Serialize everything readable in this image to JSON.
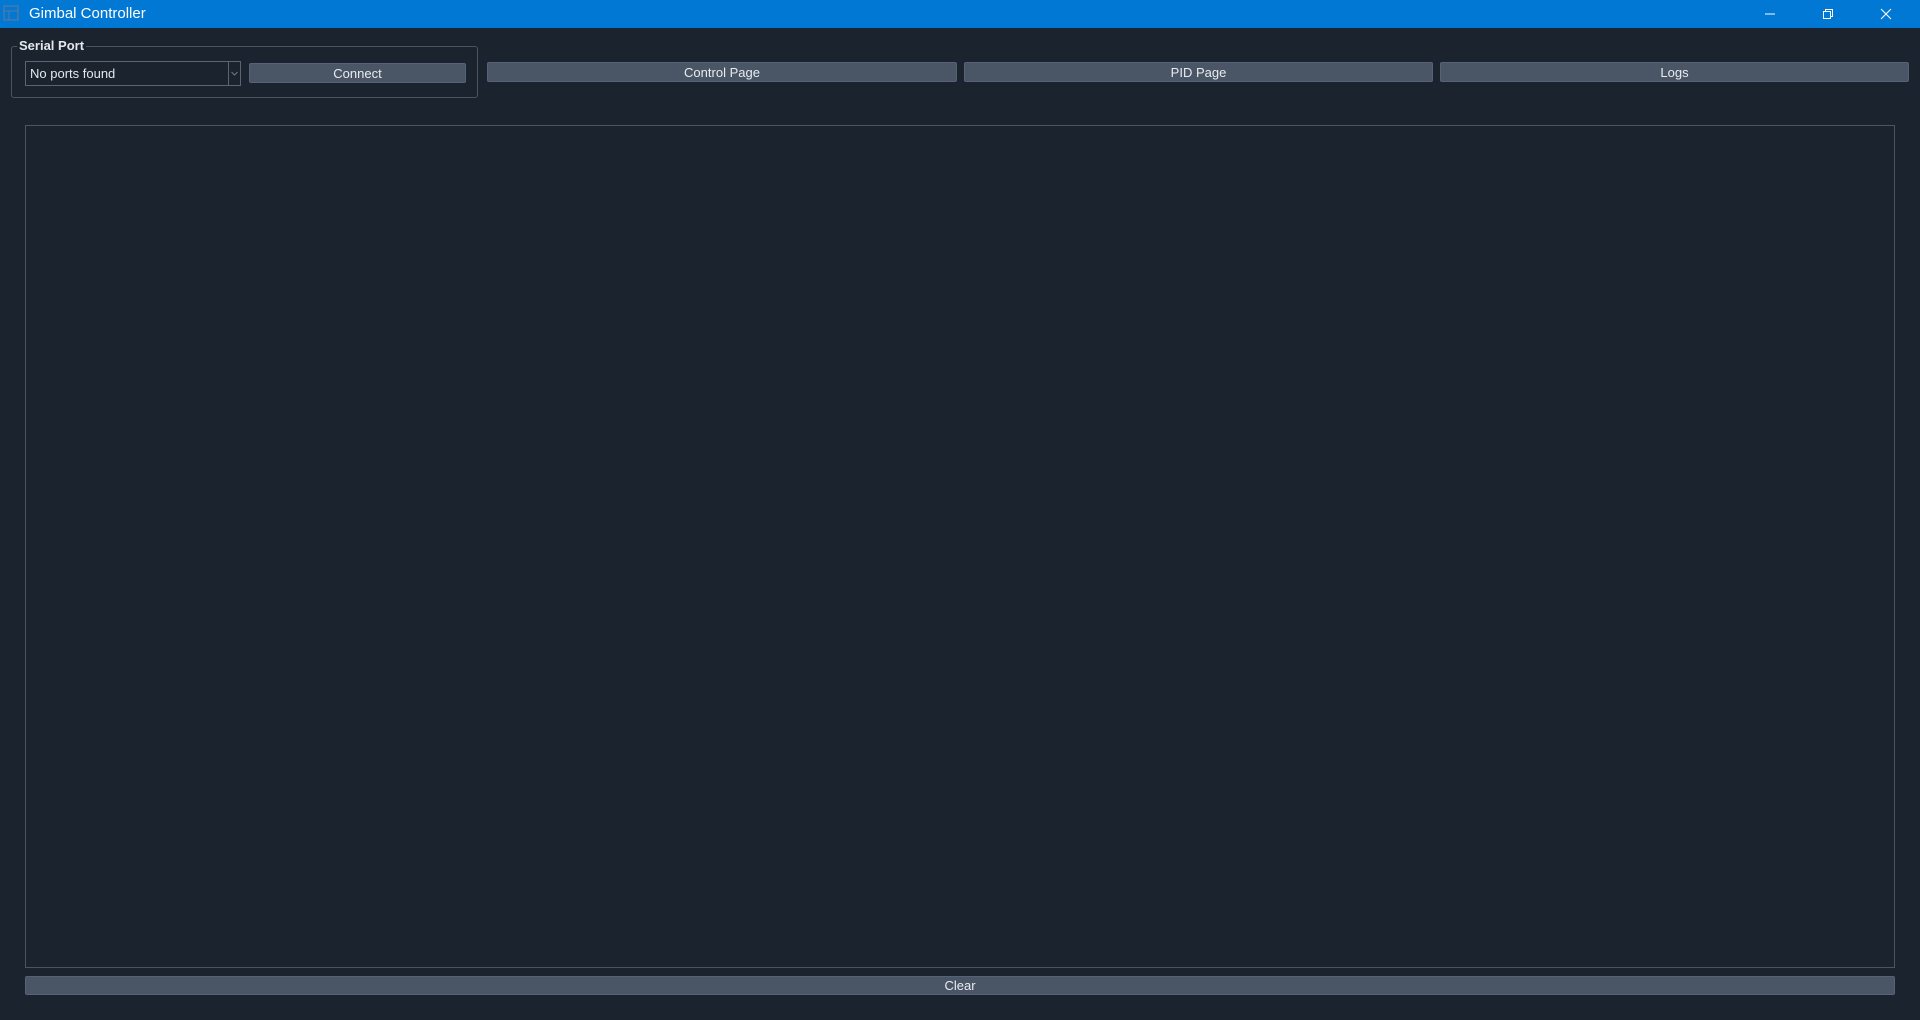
{
  "window": {
    "title": "Gimbal Controller",
    "accent_color": "#0078d4",
    "background_color": "#1a232e",
    "controls": [
      "minimize-icon",
      "restore-icon",
      "close-icon"
    ]
  },
  "serial_port": {
    "group_title": "Serial Port",
    "port_select_value": "No ports found",
    "connect_label": "Connect"
  },
  "nav": {
    "control_label": "Control Page",
    "pid_label": "PID Page",
    "logs_label": "Logs"
  },
  "log_panel": {
    "content": "",
    "clear_label": "Clear"
  }
}
